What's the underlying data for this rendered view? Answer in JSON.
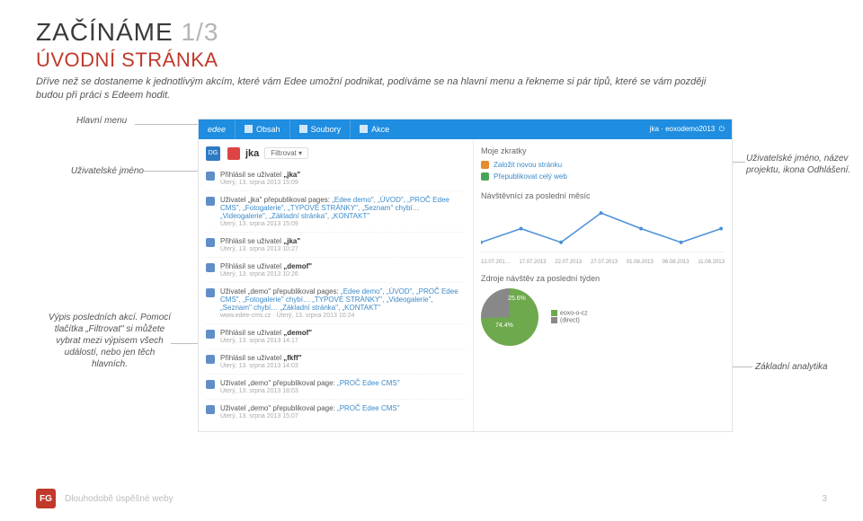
{
  "heading": {
    "main": "ZAČÍNÁME",
    "frac": "1/3",
    "sub": "ÚVODNÍ STRÁNKA"
  },
  "intro": "Dříve než se dostaneme k jednotlivým akcím, které vám Edee umožní podnikat, podíváme se na hlavní menu a řekneme si pár tipů, které se vám později budou při práci s Edeem hodit.",
  "callouts": {
    "menu": "Hlavní menu",
    "user": "Uživatelské jméno",
    "userinfo": "Uživatelské jméno, název projektu, ikona Odhlášení.",
    "events": "Výpis posledních akcí. Pomocí tlačítka „Filtrovat\" si můžete vybrat mezi výpisem všech událostí, nebo jen těch hlavních.",
    "analytics": "Základní analytika"
  },
  "nav": {
    "logo": "edee",
    "items": [
      "Obsah",
      "Soubory",
      "Akce"
    ],
    "right": {
      "user": "jka",
      "project": "eoxodemo2013"
    }
  },
  "userrow": {
    "badge": "DG",
    "name": "jka",
    "filter": "Filtrovat ▾"
  },
  "events": [
    {
      "title_a": "Přihlásil se uživatel ",
      "title_b": "„jka\"",
      "links": "",
      "meta": "Úterý, 13. srpna 2013 15:09"
    },
    {
      "title_a": "Uživatel „jka\" přepublikoval pages: ",
      "title_b": "",
      "links": "„Edee demo\", „ÚVOD\", „PROČ Edee CMS\", „Fotogalerie\", „TYPOVÉ STRÁNKY\", „Seznam\" chybí… „Videogalerie\", „Základní stránka\", „KONTAKT\"",
      "meta": "Úterý, 13. srpna 2013 15:09"
    },
    {
      "title_a": "Přihlásil se uživatel ",
      "title_b": "„jka\"",
      "links": "",
      "meta": "Úterý, 13. srpna 2013 10:27"
    },
    {
      "title_a": "Přihlásil se uživatel ",
      "title_b": "„demof\"",
      "links": "",
      "meta": "Úterý, 13. srpna 2013 10:26"
    },
    {
      "title_a": "Uživatel „demo\" přepublikoval pages: ",
      "title_b": "",
      "links": "„Edee demo\", „ÚVOD\", „PROČ Edee CMS\", „Fotogalerie\" chybí… „TYPOVÉ STRÁNKY\", „Videogalerie\", „Seznam\" chybí… „Základní stránka\", „KONTAKT\"",
      "meta": "www.edee-cms.cz · Úterý, 13. srpna 2013 10:24"
    },
    {
      "title_a": "Přihlásil se uživatel ",
      "title_b": "„demof\"",
      "links": "",
      "meta": "Úterý, 13. srpna 2013 14:17"
    },
    {
      "title_a": "Přihlásil se uživatel ",
      "title_b": "„fkff\"",
      "links": "",
      "meta": "Úterý, 13. srpna 2013 14:03"
    },
    {
      "title_a": "Uživatel „demo\" přepublikoval page: ",
      "title_b": "",
      "links": "„PROČ Edee CMS\"",
      "meta": "Úterý, 13. srpna 2013 18:03"
    },
    {
      "title_a": "Uživatel „demo\" přepublikoval page: ",
      "title_b": "",
      "links": "„PROČ Edee CMS\"",
      "meta": "Úterý, 13. srpna 2013 15:07"
    }
  ],
  "shortcuts": {
    "head": "Moje zkratky",
    "items": [
      {
        "label": "Založit novou stránku",
        "cls": ""
      },
      {
        "label": "Přepublikovat celý web",
        "cls": "green"
      }
    ]
  },
  "visits": {
    "head": "Návštěvníci za poslední měsíc",
    "xlabels": [
      "12.07.201…",
      "17.07.2013",
      "22.07.2013",
      "27.07.2013",
      "01.08.2013",
      "06.08.2013",
      "11.08.2013"
    ]
  },
  "sources": {
    "head": "Zdroje návštěv za poslední týden",
    "slices": [
      {
        "label": "74.4%",
        "color": "#6ea94e"
      },
      {
        "label": "25.6%",
        "color": "#888888"
      }
    ],
    "legend": [
      {
        "color": "#6ea94e",
        "text": "eoxo-o-cz"
      },
      {
        "color": "#888888",
        "text": "(direct)"
      }
    ]
  },
  "chart_data": {
    "type": "line",
    "title": "Návštěvníci za poslední měsíc",
    "xlabel": "",
    "ylabel": "",
    "categories": [
      "12.07.2013",
      "17.07.2013",
      "22.07.2013",
      "27.07.2013",
      "01.08.2013",
      "06.08.2013",
      "11.08.2013"
    ],
    "values": [
      1,
      2,
      1,
      3,
      2,
      1,
      2
    ],
    "ylim": [
      0,
      3
    ]
  },
  "footer": {
    "logo": "FG",
    "text": "Dlouhodobě úspěšné weby",
    "page": "3"
  }
}
